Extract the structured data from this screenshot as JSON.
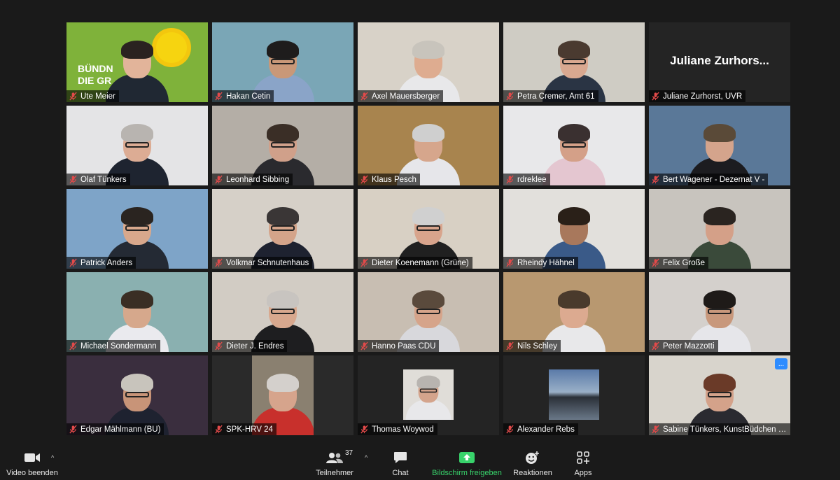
{
  "participants": [
    {
      "name": "Ute Meier",
      "bg": "#7fb23a",
      "skin": "#e2b49a",
      "hair": "#2a2220",
      "shirt": "#202833",
      "glasses": false,
      "logo": "BÜNDN DIE GR"
    },
    {
      "name": "Hakan Cetin",
      "bg": "#7aa6b6",
      "skin": "#c99878",
      "hair": "#1e1c1c",
      "shirt": "#8aa4c8",
      "glasses": true
    },
    {
      "name": "Axel Mauersberger",
      "bg": "#d8d2c8",
      "skin": "#deac90",
      "hair": "#c8c4bc",
      "shirt": "#e8e8ea",
      "glasses": false
    },
    {
      "name": "Petra Cremer, Amt 61",
      "bg": "#cfccc4",
      "skin": "#d9a890",
      "hair": "#4a3a30",
      "shirt": "#2a3444",
      "glasses": true,
      "active": true
    },
    {
      "name": "Juliane Zurhorst, UVR",
      "bg": "#242424",
      "bigname": "Juliane  Zurhors...",
      "camera_off": true
    },
    {
      "name": "Olaf Tünkers",
      "bg": "#e4e4e6",
      "skin": "#dcac94",
      "hair": "#b8b4b0",
      "shirt": "#1e2430",
      "glasses": true
    },
    {
      "name": "Leonhard Sibbing",
      "bg": "#b4aea6",
      "skin": "#d0a08a",
      "hair": "#3a2e26",
      "shirt": "#2a2a2e",
      "glasses": true
    },
    {
      "name": "Klaus Pesch",
      "bg": "#a8844e",
      "skin": "#d6a68c",
      "hair": "#cfcfcf",
      "shirt": "#e6e6ea",
      "glasses": false
    },
    {
      "name": "rdreklee",
      "bg": "#e8e8ea",
      "skin": "#d4a088",
      "hair": "#3a3030",
      "shirt": "#e4c6d0",
      "glasses": true
    },
    {
      "name": "Bert Wagener - Dezernat V -",
      "bg": "#5a7898",
      "skin": "#d4a48c",
      "hair": "#5a4a38",
      "shirt": "#1c1c20",
      "glasses": false
    },
    {
      "name": "Patrick Anders",
      "bg": "#7ea4c8",
      "skin": "#d8a88c",
      "hair": "#2a2420",
      "shirt": "#242a34",
      "glasses": true
    },
    {
      "name": "Volkmar Schnutenhaus",
      "bg": "#d6d0c8",
      "skin": "#d4a48a",
      "hair": "#3a3636",
      "shirt": "#1e2230",
      "glasses": true
    },
    {
      "name": "Dieter Koenemann (Grüne)",
      "bg": "#d8d0c4",
      "skin": "#d8a48c",
      "hair": "#d0d0d0",
      "shirt": "#202020",
      "glasses": true
    },
    {
      "name": "Rheindy Hähnel",
      "bg": "#e2e0dc",
      "skin": "#a8785c",
      "hair": "#2a2018",
      "shirt": "#3a5a88",
      "glasses": false
    },
    {
      "name": "Felix Große",
      "bg": "#c8c4be",
      "skin": "#d4a088",
      "hair": "#2a2420",
      "shirt": "#3a4a3a",
      "glasses": false
    },
    {
      "name": "Michael Sondermann",
      "bg": "#8ab0b0",
      "skin": "#d6a88c",
      "hair": "#3a2e24",
      "shirt": "#eaeaee",
      "glasses": false
    },
    {
      "name": "Dieter J. Endres",
      "bg": "#d2ccc4",
      "skin": "#d8a88e",
      "hair": "#c8c4c0",
      "shirt": "#1e1e20",
      "glasses": true
    },
    {
      "name": "Hanno Paas CDU",
      "bg": "#c8beb2",
      "skin": "#d6a48a",
      "hair": "#5a4a3c",
      "shirt": "#d8d8dc",
      "glasses": true
    },
    {
      "name": "Nils Schley",
      "bg": "#b89870",
      "skin": "#dcaa90",
      "hair": "#4a3a2c",
      "shirt": "#e8e8ea",
      "glasses": false
    },
    {
      "name": "Peter Mazzotti",
      "bg": "#d4d0cc",
      "skin": "#c8987c",
      "hair": "#1e1a18",
      "shirt": "#e6e6ea",
      "glasses": true
    },
    {
      "name": "Edgar Mählmann (BU)",
      "bg": "#3a2e3e",
      "skin": "#c89478",
      "hair": "#c8c4bc",
      "shirt": "#1e2230",
      "glasses": true
    },
    {
      "name": "SPK-HRV 24",
      "bg": "#2a2a2a",
      "skin": "#d6a48c",
      "hair": "#d4d0cc",
      "shirt": "#c8302c",
      "glasses": false,
      "small": true
    },
    {
      "name": "Thomas Woywod",
      "bg": "#242424",
      "skin": "#d4a48c",
      "hair": "#b8b4b0",
      "shirt": "#e8e8ea",
      "glasses": true,
      "avatar": true
    },
    {
      "name": "Alexander Rebs",
      "bg": "#242424",
      "landscape": true
    },
    {
      "name": "Sabine Tünkers, KunstBüdchen (A...",
      "bg": "#d8d4cc",
      "skin": "#d4a28a",
      "hair": "#6a3a28",
      "shirt": "#2a2a30",
      "glasses": true,
      "more": "..."
    }
  ],
  "toolbar": {
    "video_label": "Video beenden",
    "participants_label": "Teilnehmer",
    "participants_count": "37",
    "chat_label": "Chat",
    "share_label": "Bildschirm freigeben",
    "reactions_label": "Reaktionen",
    "apps_label": "Apps",
    "caret": "^"
  }
}
